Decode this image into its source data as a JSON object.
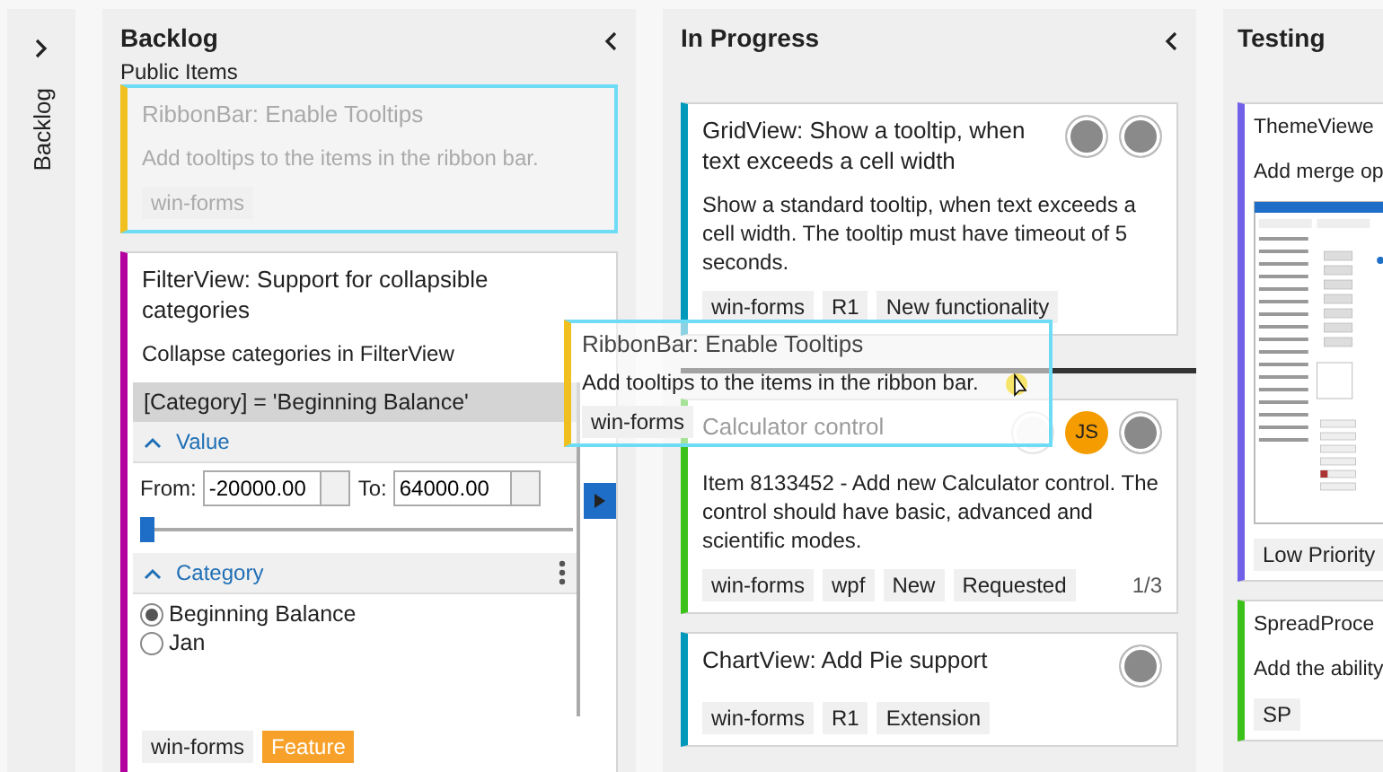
{
  "collapsed_column": {
    "title": "Backlog"
  },
  "columns": [
    {
      "title": "Backlog",
      "subtitle": "Public Items",
      "cards": [
        {
          "kind": "basic",
          "dragging": true,
          "color": "#f0c020",
          "title": "RibbonBar: Enable Tooltips",
          "description": "Add tooltips to the items in the ribbon bar.",
          "tags": [
            {
              "label": "win-forms",
              "color": "#f0f0f0"
            }
          ]
        },
        {
          "kind": "filter",
          "dragging": false,
          "color": "#b4009e",
          "title": "FilterView: Support for collapsible categories",
          "description": "Collapse categories in FilterView",
          "filter": {
            "expression": "[Category] = 'Beginning Balance'",
            "value_section": {
              "label": "Value",
              "expanded": true,
              "from_label": "From:",
              "from": "-20000.00",
              "to_label": "To:",
              "to": "64000.00",
              "level": 0
            },
            "category_section": {
              "label": "Category",
              "expanded": true,
              "options": [
                {
                  "label": "Beginning Balance",
                  "selected": true
                },
                {
                  "label": "Jan",
                  "selected": false
                }
              ]
            }
          },
          "tags": [
            {
              "label": "win-forms",
              "color": "#f0f0f0"
            },
            {
              "label": "Feature",
              "color": "#f7a12a"
            }
          ]
        }
      ]
    },
    {
      "title": "In Progress",
      "cards": [
        {
          "kind": "basic",
          "dragging": false,
          "color": "#0099bc",
          "title": "GridView: Show a tooltip, when text exceeds a cell width",
          "description": "Show a standard tooltip, when text exceeds a cell width. The tooltip must have timeout of 5 seconds.",
          "avatars": [
            {
              "kind": "photo",
              "faded": false
            },
            {
              "kind": "photo",
              "faded": false
            }
          ],
          "tags": [
            {
              "label": "win-forms",
              "color": "#f0f0f0"
            },
            {
              "label": "R1",
              "color": "#f0f0f0"
            },
            {
              "label": "New functionality",
              "color": "#f0f0f0"
            }
          ]
        },
        {
          "kind": "basic",
          "dragging": false,
          "drop_target": true,
          "color": "#3cc01a",
          "title": "Calculator control",
          "description": "Item 8133452 - Add new Calculator control. The control should have basic, advanced and scientific modes.",
          "avatars": [
            {
              "kind": "photo",
              "faded": true
            },
            {
              "kind": "initials",
              "initials": "JS",
              "faded": false
            },
            {
              "kind": "photo",
              "faded": false
            }
          ],
          "tags": [
            {
              "label": "win-forms",
              "color": "#f0f0f0"
            },
            {
              "label": "wpf",
              "color": "#f0f0f0"
            },
            {
              "label": "New",
              "color": "#f0f0f0"
            },
            {
              "label": "Requested",
              "color": "#f0f0f0"
            }
          ],
          "counter": "1/3"
        },
        {
          "kind": "basic",
          "dragging": false,
          "color": "#0099bc",
          "title": "ChartView: Add Pie support",
          "avatars": [
            {
              "kind": "photo",
              "faded": false
            }
          ],
          "tags": [
            {
              "label": "win-forms",
              "color": "#f0f0f0"
            },
            {
              "label": "R1",
              "color": "#f0f0f0"
            },
            {
              "label": "Extension",
              "color": "#f0f0f0"
            }
          ]
        }
      ]
    },
    {
      "title": "Testing",
      "cards": [
        {
          "kind": "screenshot",
          "dragging": false,
          "color": "#7160e8",
          "title": "ThemeViewe",
          "description": "Add merge op",
          "tags": [
            {
              "label": "Low Priority",
              "color": "#f0f0f0"
            }
          ]
        },
        {
          "kind": "basic",
          "dragging": false,
          "color": "#3cc01a",
          "title": "SpreadProce",
          "description": "Add the ability",
          "tags": [
            {
              "label": "SP",
              "color": "#f0f0f0"
            }
          ]
        }
      ]
    }
  ],
  "drag_ghost": {
    "color": "#f0c020",
    "title": "RibbonBar: Enable Tooltips",
    "description": "Add tooltips to the items in the ribbon bar.",
    "tags": [
      {
        "label": "win-forms",
        "color": "#f0f0f0"
      }
    ]
  }
}
